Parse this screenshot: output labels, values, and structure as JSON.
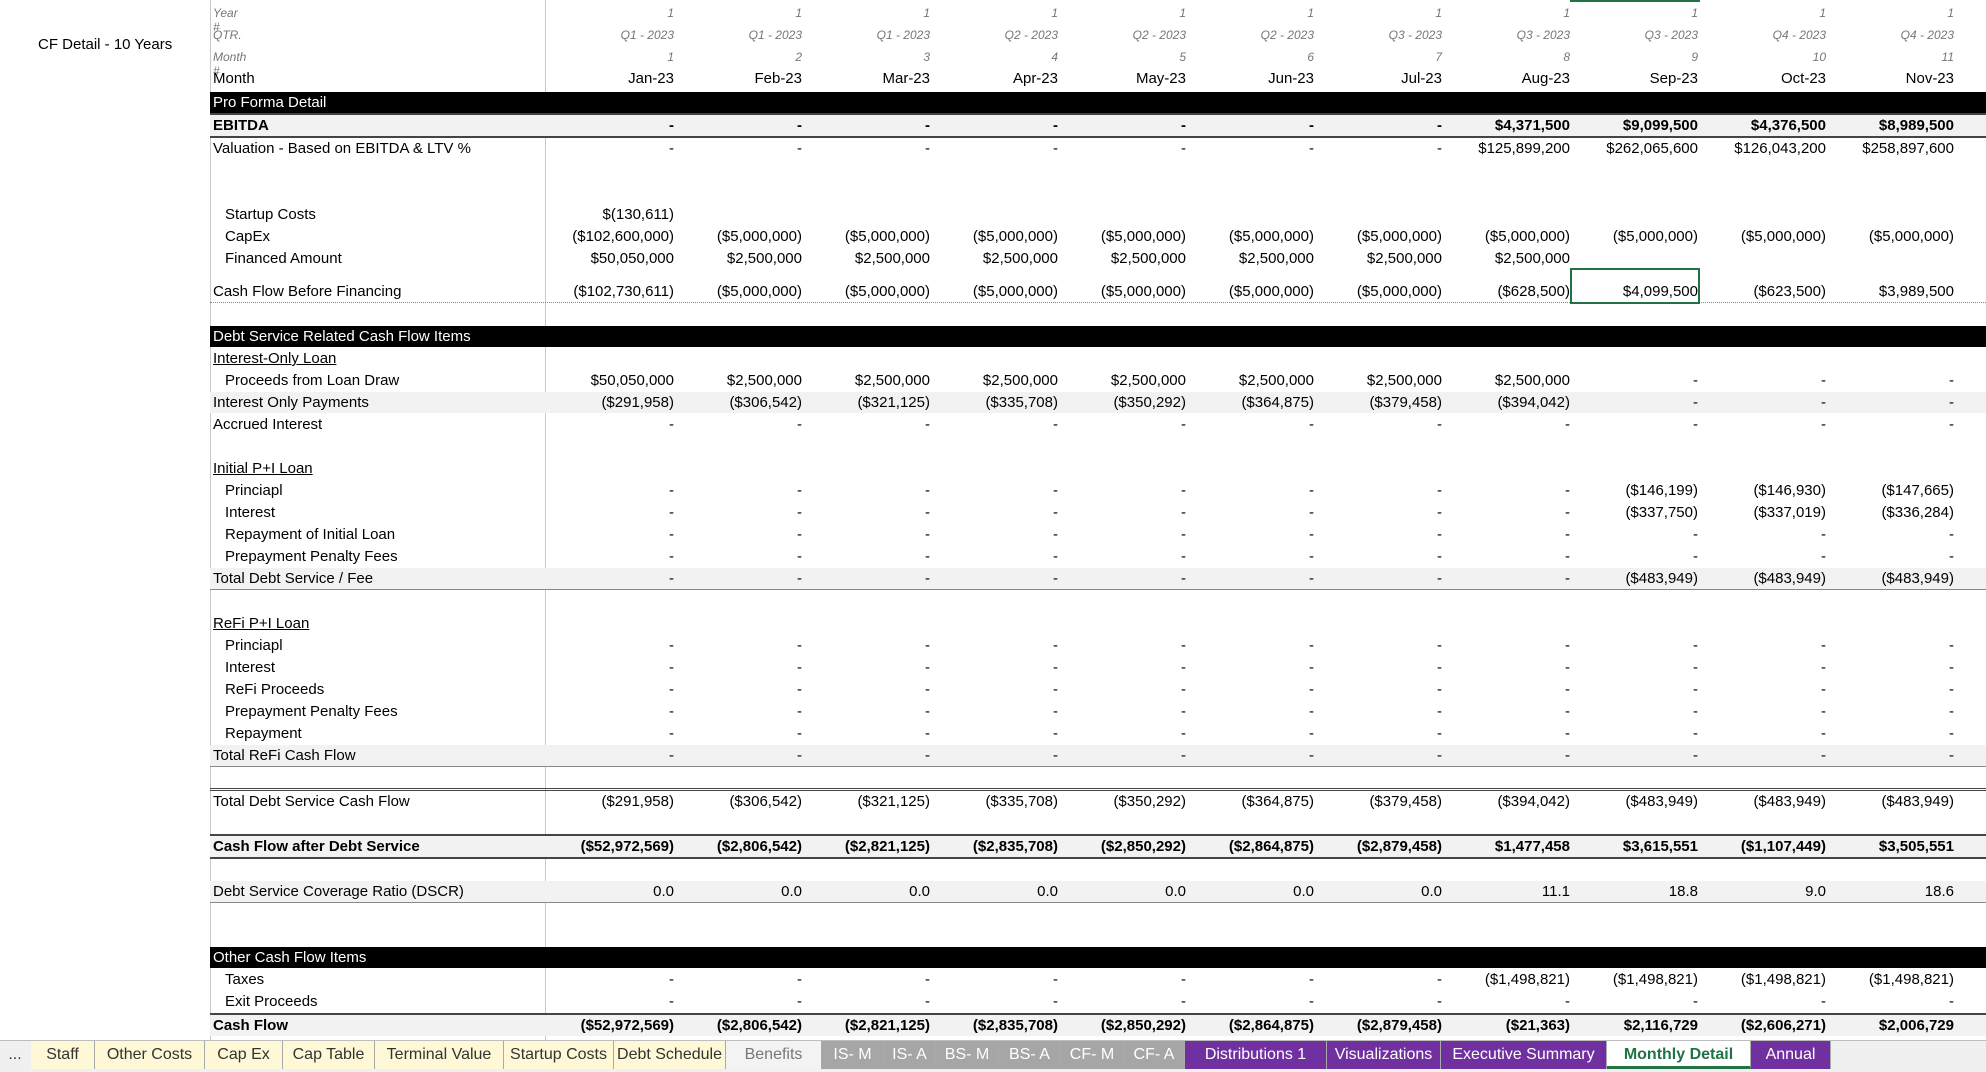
{
  "sheet_title": "CF Detail - 10 Years",
  "header": {
    "year_label": "Year #",
    "qtr_label": "QTR.",
    "monthnum_label": "Month #",
    "month_label": "Month",
    "years": [
      "1",
      "1",
      "1",
      "1",
      "1",
      "1",
      "1",
      "1",
      "1",
      "1",
      "1"
    ],
    "qtrs": [
      "Q1 - 2023",
      "Q1 - 2023",
      "Q1 - 2023",
      "Q2 - 2023",
      "Q2 - 2023",
      "Q2 - 2023",
      "Q3 - 2023",
      "Q3 - 2023",
      "Q3 - 2023",
      "Q4 - 2023",
      "Q4 - 2023"
    ],
    "month_nums": [
      "1",
      "2",
      "3",
      "4",
      "5",
      "6",
      "7",
      "8",
      "9",
      "10",
      "11"
    ],
    "months": [
      "Jan-23",
      "Feb-23",
      "Mar-23",
      "Apr-23",
      "May-23",
      "Jun-23",
      "Jul-23",
      "Aug-23",
      "Sep-23",
      "Oct-23",
      "Nov-23"
    ]
  },
  "rows": {
    "pro_forma": {
      "label": "Pro Forma Detail"
    },
    "ebitda": {
      "label": "EBITDA",
      "values": [
        "-",
        "-",
        "-",
        "-",
        "-",
        "-",
        "-",
        "$4,371,500",
        "$9,099,500",
        "$4,376,500",
        "$8,989,500"
      ]
    },
    "valuation": {
      "label": "Valuation - Based on EBITDA & LTV %",
      "values": [
        "-",
        "-",
        "-",
        "-",
        "-",
        "-",
        "-",
        "$125,899,200",
        "$262,065,600",
        "$126,043,200",
        "$258,897,600"
      ]
    },
    "startup": {
      "label": "Startup Costs",
      "values": [
        "$(130,611)",
        "",
        "",
        "",
        "",
        "",
        "",
        "",
        "",
        "",
        ""
      ]
    },
    "capex": {
      "label": "CapEx",
      "values": [
        "($102,600,000)",
        "($5,000,000)",
        "($5,000,000)",
        "($5,000,000)",
        "($5,000,000)",
        "($5,000,000)",
        "($5,000,000)",
        "($5,000,000)",
        "($5,000,000)",
        "($5,000,000)",
        "($5,000,000)"
      ]
    },
    "financed": {
      "label": "Financed Amount",
      "values": [
        "$50,050,000",
        "$2,500,000",
        "$2,500,000",
        "$2,500,000",
        "$2,500,000",
        "$2,500,000",
        "$2,500,000",
        "$2,500,000",
        "",
        "",
        ""
      ]
    },
    "cfbf": {
      "label": "Cash Flow Before Financing",
      "values": [
        "($102,730,611)",
        "($5,000,000)",
        "($5,000,000)",
        "($5,000,000)",
        "($5,000,000)",
        "($5,000,000)",
        "($5,000,000)",
        "($628,500)",
        "$4,099,500",
        "($623,500)",
        "$3,989,500"
      ]
    },
    "debt_section": {
      "label": "Debt Service Related Cash Flow Items"
    },
    "io_loan": {
      "label": "Interest-Only Loan"
    },
    "proceeds": {
      "label": "Proceeds from Loan Draw",
      "values": [
        "$50,050,000",
        "$2,500,000",
        "$2,500,000",
        "$2,500,000",
        "$2,500,000",
        "$2,500,000",
        "$2,500,000",
        "$2,500,000",
        "-",
        "-",
        "-"
      ]
    },
    "io_payments": {
      "label": "Interest Only Payments",
      "values": [
        "($291,958)",
        "($306,542)",
        "($321,125)",
        "($335,708)",
        "($350,292)",
        "($364,875)",
        "($379,458)",
        "($394,042)",
        "-",
        "-",
        "-"
      ]
    },
    "accrued": {
      "label": "Accrued Interest",
      "values": [
        "-",
        "-",
        "-",
        "-",
        "-",
        "-",
        "-",
        "-",
        "-",
        "-",
        "-"
      ]
    },
    "init_loan": {
      "label": "Initial P+I Loan"
    },
    "init_principal": {
      "label": "Princiapl",
      "values": [
        "-",
        "-",
        "-",
        "-",
        "-",
        "-",
        "-",
        "-",
        "($146,199)",
        "($146,930)",
        "($147,665)"
      ]
    },
    "init_interest": {
      "label": "Interest",
      "values": [
        "-",
        "-",
        "-",
        "-",
        "-",
        "-",
        "-",
        "-",
        "($337,750)",
        "($337,019)",
        "($336,284)"
      ]
    },
    "init_repay": {
      "label": "Repayment of Initial Loan",
      "values": [
        "-",
        "-",
        "-",
        "-",
        "-",
        "-",
        "-",
        "-",
        "-",
        "-",
        "-"
      ]
    },
    "init_penalty": {
      "label": "Prepayment Penalty Fees",
      "values": [
        "-",
        "-",
        "-",
        "-",
        "-",
        "-",
        "-",
        "-",
        "-",
        "-",
        "-"
      ]
    },
    "total_ds": {
      "label": "Total Debt Service / Fee",
      "values": [
        "-",
        "-",
        "-",
        "-",
        "-",
        "-",
        "-",
        "-",
        "($483,949)",
        "($483,949)",
        "($483,949)"
      ]
    },
    "refi_loan": {
      "label": "ReFi P+I Loan"
    },
    "refi_principal": {
      "label": "Princiapl",
      "values": [
        "-",
        "-",
        "-",
        "-",
        "-",
        "-",
        "-",
        "-",
        "-",
        "-",
        "-"
      ]
    },
    "refi_interest": {
      "label": "Interest",
      "values": [
        "-",
        "-",
        "-",
        "-",
        "-",
        "-",
        "-",
        "-",
        "-",
        "-",
        "-"
      ]
    },
    "refi_proceeds": {
      "label": "ReFi Proceeds",
      "values": [
        "-",
        "-",
        "-",
        "-",
        "-",
        "-",
        "-",
        "-",
        "-",
        "-",
        "-"
      ]
    },
    "refi_penalty": {
      "label": "Prepayment Penalty Fees",
      "values": [
        "-",
        "-",
        "-",
        "-",
        "-",
        "-",
        "-",
        "-",
        "-",
        "-",
        "-"
      ]
    },
    "refi_repay": {
      "label": "Repayment",
      "values": [
        "-",
        "-",
        "-",
        "-",
        "-",
        "-",
        "-",
        "-",
        "-",
        "-",
        "-"
      ]
    },
    "total_refi": {
      "label": "Total ReFi Cash Flow",
      "values": [
        "-",
        "-",
        "-",
        "-",
        "-",
        "-",
        "-",
        "-",
        "-",
        "-",
        "-"
      ]
    },
    "total_dscf": {
      "label": "Total Debt Service Cash Flow",
      "values": [
        "($291,958)",
        "($306,542)",
        "($321,125)",
        "($335,708)",
        "($350,292)",
        "($364,875)",
        "($379,458)",
        "($394,042)",
        "($483,949)",
        "($483,949)",
        "($483,949)"
      ]
    },
    "cfads": {
      "label": "Cash Flow after Debt Service",
      "values": [
        "($52,972,569)",
        "($2,806,542)",
        "($2,821,125)",
        "($2,835,708)",
        "($2,850,292)",
        "($2,864,875)",
        "($2,879,458)",
        "$1,477,458",
        "$3,615,551",
        "($1,107,449)",
        "$3,505,551"
      ]
    },
    "dscr": {
      "label": "Debt Service Coverage Ratio (DSCR)",
      "values": [
        "0.0",
        "0.0",
        "0.0",
        "0.0",
        "0.0",
        "0.0",
        "0.0",
        "11.1",
        "18.8",
        "9.0",
        "18.6"
      ]
    },
    "other_section": {
      "label": "Other Cash Flow Items"
    },
    "taxes": {
      "label": "Taxes",
      "values": [
        "-",
        "-",
        "-",
        "-",
        "-",
        "-",
        "-",
        "($1,498,821)",
        "($1,498,821)",
        "($1,498,821)",
        "($1,498,821)"
      ]
    },
    "exit": {
      "label": "Exit Proceeds",
      "values": [
        "-",
        "-",
        "-",
        "-",
        "-",
        "-",
        "-",
        "-",
        "-",
        "-",
        "-"
      ]
    },
    "cashflow": {
      "label": "Cash Flow",
      "values": [
        "($52,972,569)",
        "($2,806,542)",
        "($2,821,125)",
        "($2,835,708)",
        "($2,850,292)",
        "($2,864,875)",
        "($2,879,458)",
        "($21,363)",
        "$2,116,729",
        "($2,606,271)",
        "$2,006,729"
      ]
    }
  },
  "tabs": {
    "more": "...",
    "items": [
      {
        "label": "Staff",
        "style": "yellow"
      },
      {
        "label": "Other Costs",
        "style": "yellow"
      },
      {
        "label": "Cap Ex",
        "style": "yellow"
      },
      {
        "label": "Cap Table",
        "style": "yellow"
      },
      {
        "label": "Terminal Value",
        "style": "yellow"
      },
      {
        "label": "Startup Costs",
        "style": "yellow"
      },
      {
        "label": "Debt Schedule",
        "style": "yellow"
      },
      {
        "label": "Benefits",
        "style": "plain"
      },
      {
        "label": "IS- M",
        "style": "gray"
      },
      {
        "label": "IS- A",
        "style": "gray"
      },
      {
        "label": "BS- M",
        "style": "gray"
      },
      {
        "label": "BS- A",
        "style": "gray"
      },
      {
        "label": "CF- M",
        "style": "gray"
      },
      {
        "label": "CF- A",
        "style": "gray"
      },
      {
        "label": "Distributions 1",
        "style": "purple"
      },
      {
        "label": "Visualizations",
        "style": "purple"
      },
      {
        "label": "Executive Summary",
        "style": "purple"
      },
      {
        "label": "Monthly Detail",
        "style": "active"
      },
      {
        "label": "Annual",
        "style": "purple"
      }
    ]
  },
  "colors": {
    "accent": "#217346",
    "purple_tab": "#7030a0",
    "gray_tab": "#a6a6a6",
    "yellow_tab": "#fff8d6"
  }
}
